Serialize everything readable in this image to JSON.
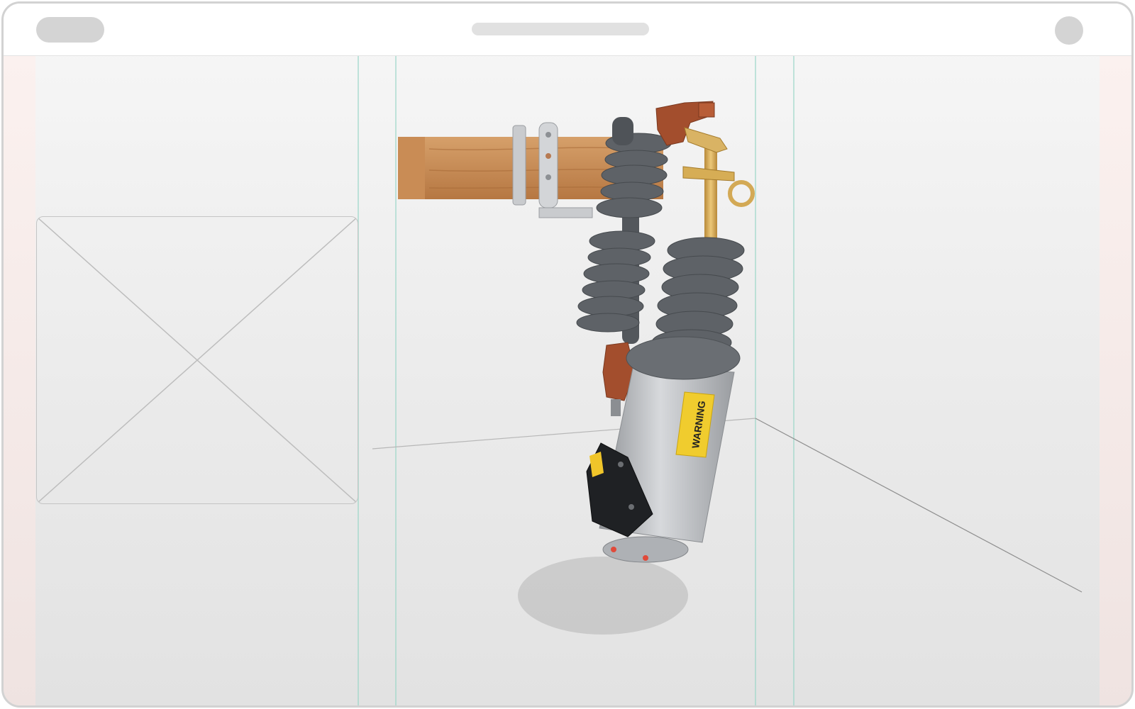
{
  "colors": {
    "guide_line": "#8fd3c3",
    "wood": "#c98a52",
    "insulator": "#5d6166",
    "bronze": "#a9522f",
    "brass": "#d6ad55",
    "metal_body": "#b9bcc0",
    "warning_label": "#f2cf2c"
  },
  "product": {
    "name": "fused-cutout-with-lightning-arrester",
    "label_text": "WARNING"
  },
  "placeholder": {
    "type": "image-placeholder"
  }
}
